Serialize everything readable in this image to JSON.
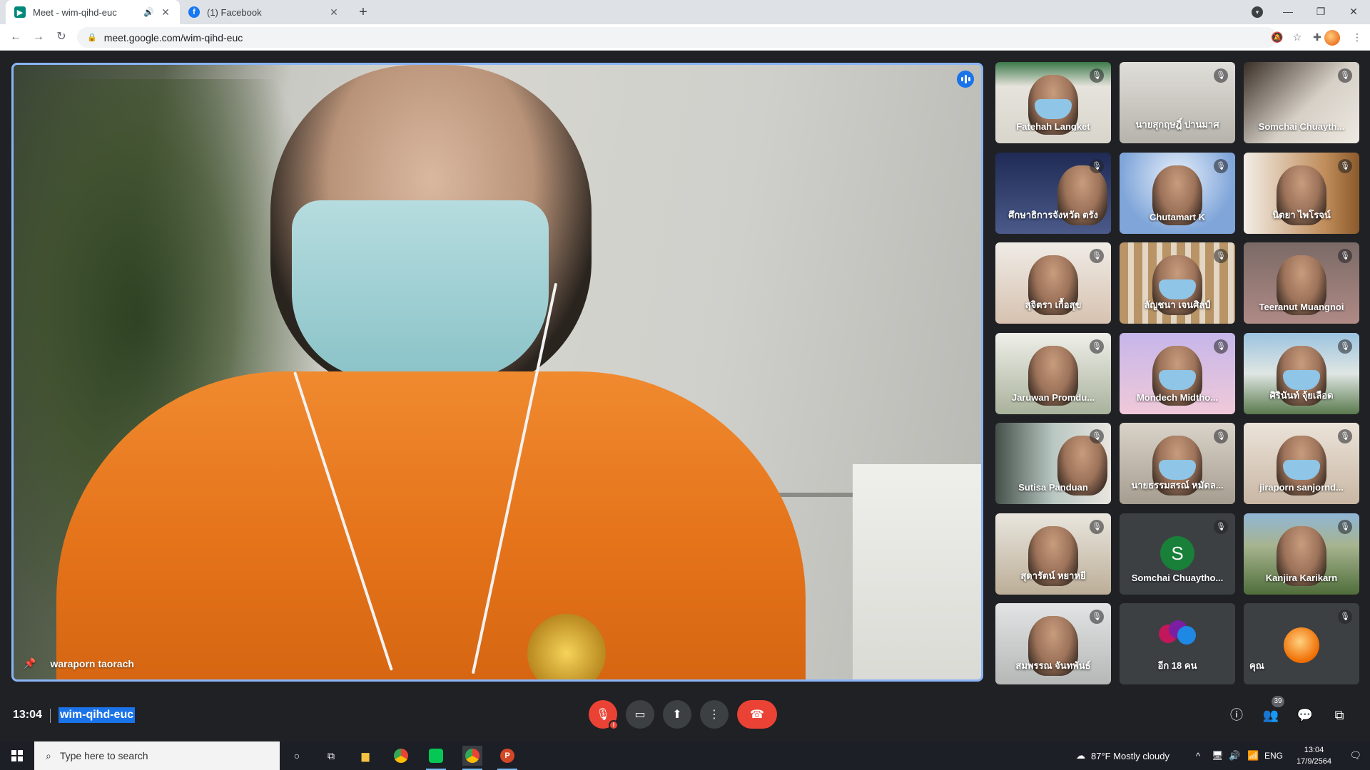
{
  "browser": {
    "tabs": [
      {
        "title": "Meet - wim-qihd-euc",
        "favicon": "meet-icon"
      },
      {
        "title": "(1) Facebook",
        "favicon": "facebook-icon"
      }
    ],
    "url": "meet.google.com/wim-qihd-euc"
  },
  "meet": {
    "main_speaker": "waraporn taorach",
    "participants": [
      {
        "name": "Fatehah Langket"
      },
      {
        "name": "นายสุกฤษฎิ์ ปานมาศ"
      },
      {
        "name": "Somchai Chuayth..."
      },
      {
        "name": "ศึกษาธิการจังหวัด ตรัง"
      },
      {
        "name": "Chutamart K"
      },
      {
        "name": "นิตยา ไพโรจน์"
      },
      {
        "name": "สุจิตรา เกื้อสุข"
      },
      {
        "name": "ลัญชนา เจนศิลป์"
      },
      {
        "name": "Teeranut Muangnoi"
      },
      {
        "name": "Jaruwan Promdu..."
      },
      {
        "name": "Mondech Midtho..."
      },
      {
        "name": "ศิรินันท์ จุ้ยเลือด"
      },
      {
        "name": "Sutisa Panduan"
      },
      {
        "name": "นายธรรมสรณ์ หมัดล..."
      },
      {
        "name": "jiraporn sanjornd..."
      },
      {
        "name": "สุดารัตน์ หยาหยี"
      },
      {
        "name": "Somchai Chuaytho...",
        "avatar_letter": "S"
      },
      {
        "name": "Kanjira Karikarn"
      },
      {
        "name": "สมพรรณ จันทพันธ์"
      },
      {
        "name": "อีก 18 คน"
      },
      {
        "name": "คุณ"
      }
    ],
    "time": "13:04",
    "meeting_code": "wim-qihd-euc",
    "people_count": "39"
  },
  "taskbar": {
    "search_placeholder": "Type here to search",
    "weather": "87°F  Mostly cloudy",
    "language": "ENG",
    "clock_time": "13:04",
    "clock_date": "17/9/2564"
  },
  "colors": {
    "accent": "#1a73e8",
    "end_call": "#ea4335",
    "speaking_border": "#8ab4f8"
  }
}
